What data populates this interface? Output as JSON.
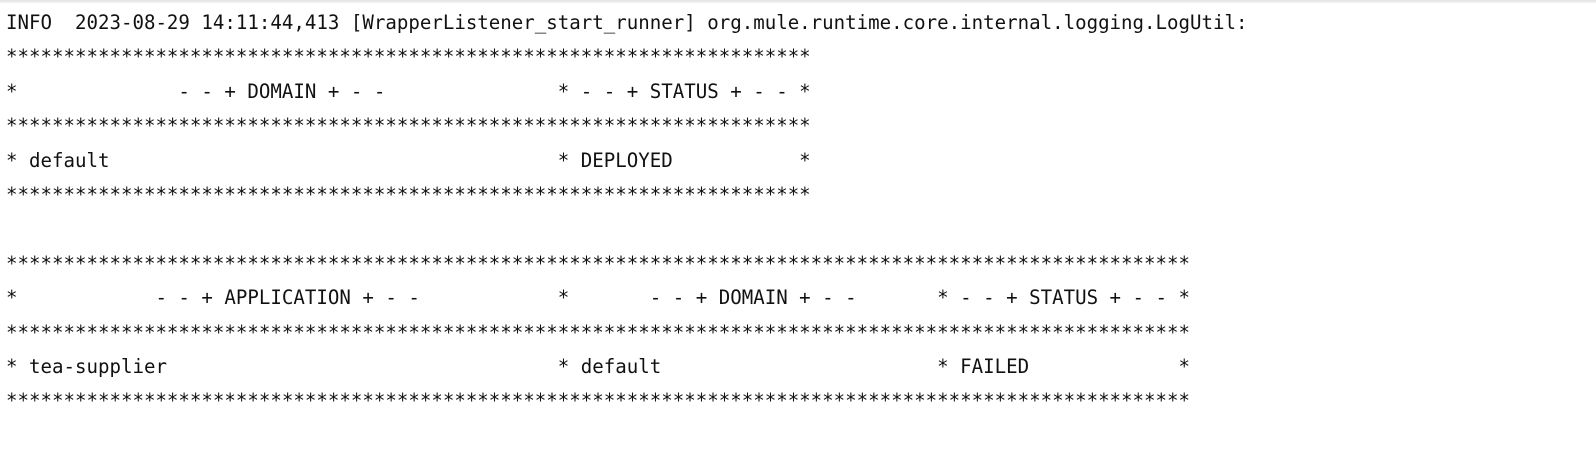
{
  "log_lines": [
    "INFO  2023-08-29 14:11:44,413 [WrapperListener_start_runner] org.mule.runtime.core.internal.logging.LogUtil:",
    "**********************************************************************",
    "*              - - + DOMAIN + - -               * - - + STATUS + - - *",
    "**********************************************************************",
    "* default                                       * DEPLOYED           *",
    "**********************************************************************",
    "",
    "*******************************************************************************************************",
    "*            - - + APPLICATION + - -            *       - - + DOMAIN + - -       * - - + STATUS + - - *",
    "*******************************************************************************************************",
    "* tea-supplier                                  * default                        * FAILED             *",
    "*******************************************************************************************************"
  ]
}
